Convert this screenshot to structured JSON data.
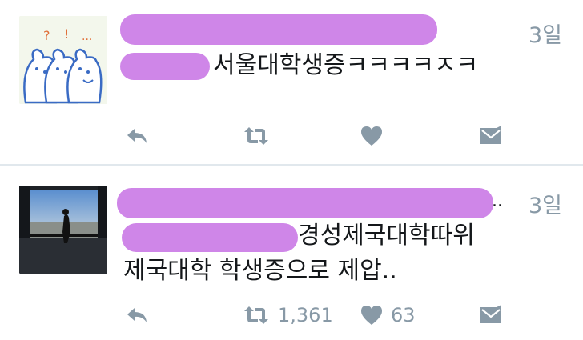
{
  "tweets": [
    {
      "time": "3일",
      "text_line1": "서울대학생증ㅋㅋㅋㅋㅈㅋ",
      "text_line2": "",
      "retweet_count": "",
      "like_count": ""
    },
    {
      "time": "3일",
      "text_line1": "경성제국대학따위",
      "text_line2": "제국대학 학생증으로 제압..",
      "retweet_count": "1,361",
      "like_count": "63",
      "truncation_mark": ".."
    }
  ],
  "colors": {
    "icon_gray": "#8899a6",
    "redaction": "#cf86e8",
    "divider": "#e1e8ed"
  },
  "icons": [
    "reply-icon",
    "retweet-icon",
    "heart-icon",
    "direct-message-icon"
  ]
}
